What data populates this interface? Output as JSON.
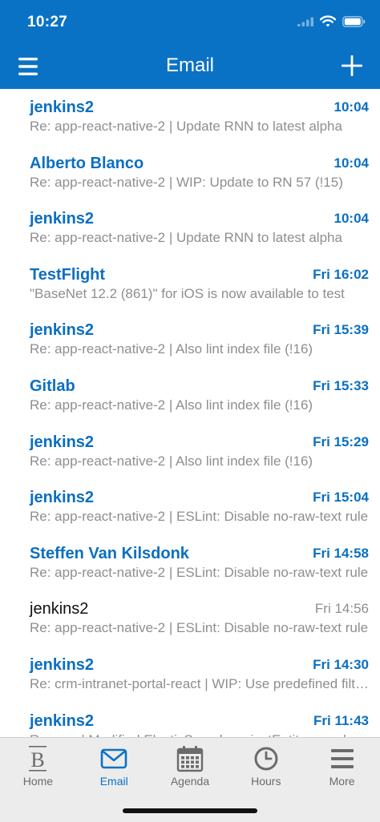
{
  "status_bar": {
    "time": "10:27"
  },
  "nav": {
    "title": "Email"
  },
  "emails": [
    {
      "sender": "jenkins2",
      "time": "10:04",
      "preview": "Re: app-react-native-2 | Update RNN to latest alpha",
      "unread": true
    },
    {
      "sender": "Alberto Blanco",
      "time": "10:04",
      "preview": "Re: app-react-native-2 | WIP: Update to RN 57 (!15)",
      "unread": true
    },
    {
      "sender": "jenkins2",
      "time": "10:04",
      "preview": "Re: app-react-native-2 | Update RNN to latest alpha",
      "unread": true
    },
    {
      "sender": "TestFlight",
      "time": "Fri 16:02",
      "preview": "\"BaseNet 12.2 (861)\" for iOS is now available to test",
      "unread": true
    },
    {
      "sender": "jenkins2",
      "time": "Fri 15:39",
      "preview": "Re: app-react-native-2 | Also lint index file (!16)",
      "unread": true
    },
    {
      "sender": "Gitlab",
      "time": "Fri 15:33",
      "preview": "Re: app-react-native-2 | Also lint index file (!16)",
      "unread": true
    },
    {
      "sender": "jenkins2",
      "time": "Fri 15:29",
      "preview": "Re: app-react-native-2 | Also lint index file (!16)",
      "unread": true
    },
    {
      "sender": "jenkins2",
      "time": "Fri 15:04",
      "preview": "Re: app-react-native-2 | ESLint: Disable no-raw-text rule",
      "unread": true
    },
    {
      "sender": "Steffen Van Kilsdonk",
      "time": "Fri 14:58",
      "preview": "Re: app-react-native-2 | ESLint: Disable no-raw-text rule",
      "unread": true
    },
    {
      "sender": "jenkins2",
      "time": "Fri 14:56",
      "preview": "Re: app-react-native-2 | ESLint: Disable no-raw-text rule",
      "unread": false
    },
    {
      "sender": "jenkins2",
      "time": "Fri 14:30",
      "preview": "Re: crm-intranet-portal-react | WIP: Use predefined filters",
      "unread": true
    },
    {
      "sender": "jenkins2",
      "time": "Fri 11:43",
      "preview": "Re: crm | Modified ElasticSearch projectEntity search",
      "unread": true
    }
  ],
  "tabs": [
    {
      "label": "Home",
      "icon": "basenet-logo-icon",
      "active": false
    },
    {
      "label": "Email",
      "icon": "envelope-icon",
      "active": true
    },
    {
      "label": "Agenda",
      "icon": "calendar-icon",
      "active": false
    },
    {
      "label": "Hours",
      "icon": "clock-icon",
      "active": false
    },
    {
      "label": "More",
      "icon": "menu-icon",
      "active": false
    }
  ],
  "colors": {
    "brand": "#0a72c5",
    "unread_text": "#0a6fc2",
    "preview_text": "#8e8e93",
    "tab_bar": "#ececec"
  }
}
